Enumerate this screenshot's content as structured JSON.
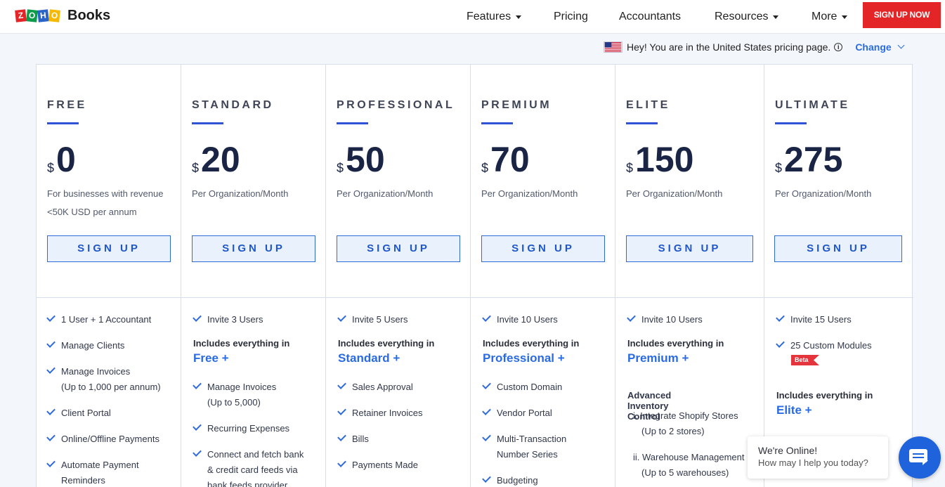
{
  "header": {
    "logo_letters": [
      "Z",
      "O",
      "H",
      "O"
    ],
    "logo_colors": [
      "#e42527",
      "#0d9c4a",
      "#2b64c6",
      "#f6b900"
    ],
    "brand": "Books",
    "nav": [
      {
        "label": "Features",
        "dropdown": true
      },
      {
        "label": "Pricing",
        "dropdown": false
      },
      {
        "label": "Accountants",
        "dropdown": false
      },
      {
        "label": "Resources",
        "dropdown": true
      },
      {
        "label": "More",
        "dropdown": true
      }
    ],
    "cta": "SIGN UP NOW"
  },
  "region": {
    "flag_icon": "us-flag-icon",
    "text": "Hey! You are in the United States pricing page.",
    "info_icon": "i",
    "change": "Change"
  },
  "plans": [
    {
      "name": "FREE",
      "currency": "$",
      "price": "0",
      "per": [
        "For businesses with revenue",
        "<50K USD per annum"
      ],
      "button": "SIGN UP",
      "features": [
        "1 User + 1 Accountant",
        "Manage Clients",
        "Manage Invoices",
        "(Up to 1,000 per annum)",
        "Client Portal",
        "Online/Offline Payments",
        "Automate Payment",
        "Reminders"
      ]
    },
    {
      "name": "STANDARD",
      "currency": "$",
      "price": "20",
      "per": [
        "Per Organization/Month"
      ],
      "button": "SIGN UP",
      "features": [
        "Invite 3 Users",
        "Manage Invoices",
        "(Up to 5,000)",
        "Recurring Expenses",
        "Connect and fetch bank",
        "& credit card feeds via",
        "bank feeds provider"
      ],
      "includes": "Includes everything in",
      "includes_plan": "Free +"
    },
    {
      "name": "PROFESSIONAL",
      "currency": "$",
      "price": "50",
      "per": [
        "Per Organization/Month"
      ],
      "button": "SIGN UP",
      "features": [
        "Invite 5 Users",
        "Sales Approval",
        "Retainer Invoices",
        "Bills",
        "Payments Made"
      ],
      "includes": "Includes everything in",
      "includes_plan": "Standard +"
    },
    {
      "name": "PREMIUM",
      "currency": "$",
      "price": "70",
      "per": [
        "Per Organization/Month"
      ],
      "button": "SIGN UP",
      "features": [
        "Invite 10 Users",
        "Custom Domain",
        "Vendor Portal",
        "Multi-Transaction",
        "Number Series",
        "Budgeting"
      ],
      "includes": "Includes everything in",
      "includes_plan": "Professional +"
    },
    {
      "name": "ELITE",
      "currency": "$",
      "price": "150",
      "per": [
        "Per Organization/Month"
      ],
      "button": "SIGN UP",
      "features": [
        "Invite 10 Users"
      ],
      "includes": "Includes everything in",
      "includes_plan": "Premium +",
      "subhead": "Advanced Inventory Control",
      "numbered": [
        "i. Integrate Shopify Stores",
        "(Up to 2 stores)",
        "ii. Warehouse Management",
        "(Up to 5 warehouses)"
      ]
    },
    {
      "name": "ULTIMATE",
      "currency": "$",
      "price": "275",
      "per": [
        "Per Organization/Month"
      ],
      "button": "SIGN UP",
      "features": [
        "Invite 15 Users",
        "25 Custom Modules"
      ],
      "badge": "Beta",
      "includes": "Includes everything in",
      "includes_plan": "Elite +"
    }
  ],
  "chat": {
    "title": "We're Online!",
    "subtitle": "How may I help you today?"
  }
}
